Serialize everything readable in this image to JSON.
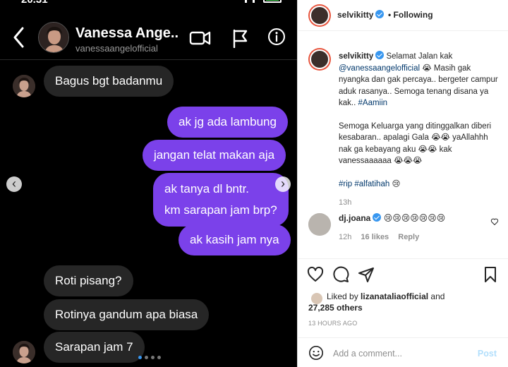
{
  "dm": {
    "status_time": "20.31",
    "header": {
      "name": "Vanessa Ange...",
      "username": "vanessaangelofficial"
    },
    "messages": [
      {
        "side": "in",
        "text": "Bagus bgt badanmu"
      },
      {
        "side": "out",
        "text": "ak jg ada lambung"
      },
      {
        "side": "out",
        "text": "jangan telat makan aja"
      },
      {
        "side": "out",
        "lines": [
          "ak tanya dl bntr.",
          "km sarapan jam brp?"
        ]
      },
      {
        "side": "out",
        "text": "ak kasih jam nya"
      },
      {
        "side": "in",
        "text": "Roti pisang?"
      },
      {
        "side": "in",
        "text": "Rotinya gandum apa biasa"
      },
      {
        "side": "in",
        "text": "Sarapan jam 7"
      }
    ],
    "carousel": {
      "prev_glyph": "‹",
      "next_glyph": "›",
      "dot_count": 4,
      "active_dot": 1
    }
  },
  "post": {
    "author": "selvikitty",
    "following_label": "• Following",
    "caption": {
      "author": "selvikitty",
      "intro": "Selamat Jalan kak",
      "mention": "@vanessaangelofficial",
      "emoji_1": "😭",
      "line_2": "Masih gak nyangka dan gak percaya.. bergeter campur aduk rasanya.. Semoga tenang disana ya kak..",
      "hashtag_1": "#Aamiin",
      "para_2_a": "Semoga Keluarga yang ditinggalkan diberi kesabaran.. apalagi Gala",
      "emoji_2": "😭😭",
      "para_2_b": "yaAllahhh nak ga kebayang aku",
      "emoji_3": "😭😭",
      "para_2_c": "kak vanessaaaaaa",
      "emoji_4": "😭😭😭",
      "hashtags": "#rip #alfatihah",
      "emoji_5": "😢",
      "time": "13h"
    },
    "comment": {
      "author": "dj.joana",
      "text": "😢😢😢😢😢😢😢",
      "time": "12h",
      "likes": "16 likes",
      "reply": "Reply"
    },
    "likes": {
      "prefix": "Liked by",
      "liker": "lizanataliaofficial",
      "and": "and",
      "count": "27,285 others"
    },
    "time_ago": "13 HOURS AGO",
    "add_comment_placeholder": "Add a comment...",
    "post_label": "Post",
    "icons": [
      "heart-icon",
      "comment-icon",
      "share-icon",
      "bookmark-icon"
    ]
  }
}
